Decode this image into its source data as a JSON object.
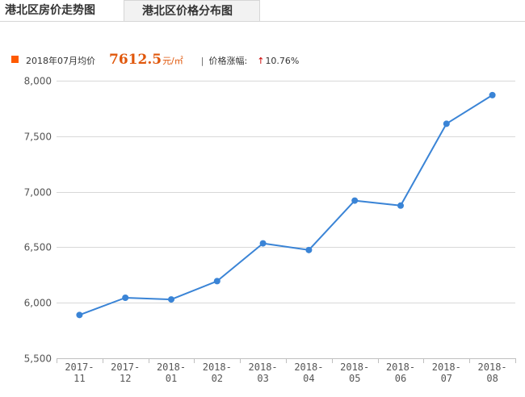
{
  "tabs": [
    {
      "label": "港北区房价走势图"
    },
    {
      "label": "港北区价格分布图"
    }
  ],
  "summary": {
    "month_label": "2018年07月均价",
    "price": "7612.5",
    "unit": "元/㎡",
    "separator": "|",
    "change_label": "价格涨幅:",
    "change_arrow": "↑",
    "change_value": "10.76%",
    "marker_color": "#ff5a00",
    "price_color": "#e0570b"
  },
  "chart_data": {
    "type": "line",
    "title": "",
    "xlabel": "",
    "ylabel": "",
    "categories": [
      [
        "2017-",
        "11"
      ],
      [
        "2017-",
        "12"
      ],
      [
        "2018-",
        "01"
      ],
      [
        "2018-",
        "02"
      ],
      [
        "2018-",
        "03"
      ],
      [
        "2018-",
        "04"
      ],
      [
        "2018-",
        "05"
      ],
      [
        "2018-",
        "06"
      ],
      [
        "2018-",
        "07"
      ],
      [
        "2018-",
        "08"
      ]
    ],
    "series": [
      {
        "values": [
          5890,
          6045,
          6030,
          6195,
          6535,
          6475,
          6920,
          6875,
          7612.5,
          7870
        ],
        "color": "#3a84d6"
      }
    ],
    "ylim": [
      5500,
      8000
    ],
    "yticks": [
      5500,
      6000,
      6500,
      7000,
      7500,
      8000
    ],
    "ytick_labels": [
      "5,500",
      "6,000",
      "6,500",
      "7,000",
      "7,500",
      "8,000"
    ],
    "grid": true,
    "legend": "none"
  }
}
